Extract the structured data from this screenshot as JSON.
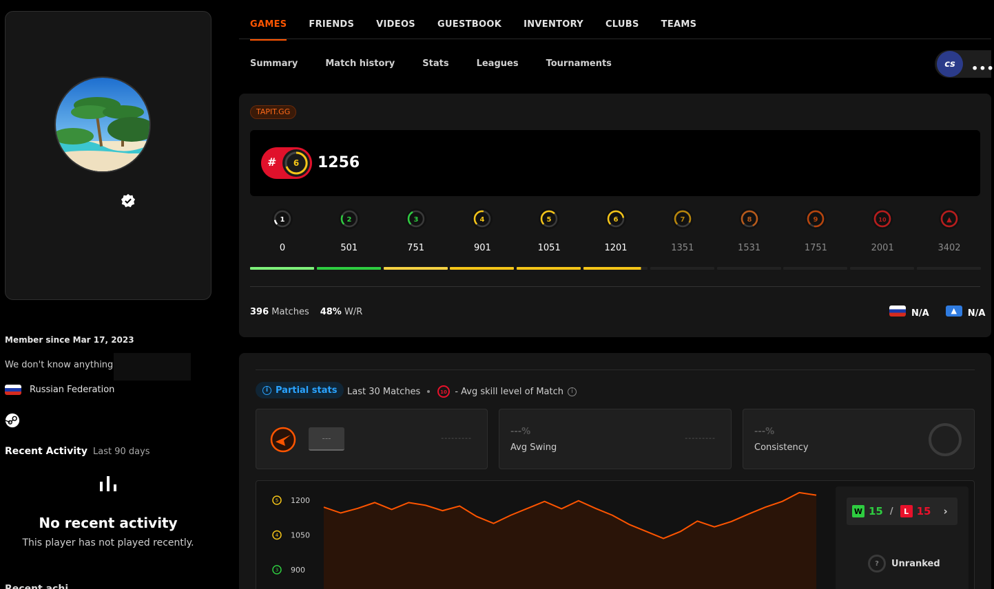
{
  "nav": {
    "main_tabs": [
      "GAMES",
      "FRIENDS",
      "VIDEOS",
      "GUESTBOOK",
      "INVENTORY",
      "CLUBS",
      "TEAMS"
    ],
    "sub_tabs": [
      "Summary",
      "Match history",
      "Stats",
      "Leagues",
      "Tournaments"
    ],
    "game_logo": "cs",
    "more": "•••"
  },
  "profile": {
    "member_since": "Member since Mar 17, 2023",
    "bio": "We don't know anything",
    "country": "Russian Federation",
    "recent_activity_title": "Recent Activity",
    "recent_activity_sub": "Last 90 days",
    "no_recent_title": "No recent activity",
    "no_recent_sub": "This player has not played recently.",
    "cut_text": "Recent achi..."
  },
  "rating": {
    "badge": "TAPIT.GG",
    "hash": "#",
    "current_level": "6",
    "elo": "1256",
    "levels": [
      {
        "label": "1",
        "value": "0",
        "color": "#ffffff",
        "bar": "#7ef07a",
        "active": true
      },
      {
        "label": "2",
        "value": "501",
        "color": "#2ecc40",
        "bar": "#2ecc40",
        "active": true
      },
      {
        "label": "3",
        "value": "751",
        "color": "#2ecc40",
        "bar": "#f5d142",
        "active": true
      },
      {
        "label": "4",
        "value": "901",
        "color": "#f5c518",
        "bar": "#f5c518",
        "active": true
      },
      {
        "label": "5",
        "value": "1051",
        "color": "#f5c518",
        "bar": "#f5c518",
        "active": true
      },
      {
        "label": "6",
        "value": "1201",
        "color": "#f5c518",
        "bar": "#f5c518",
        "active": true
      },
      {
        "label": "7",
        "value": "1351",
        "color": "#b8860b",
        "bar": "#222",
        "active": false
      },
      {
        "label": "8",
        "value": "1531",
        "color": "#b85a1a",
        "bar": "#222",
        "active": false
      },
      {
        "label": "9",
        "value": "1751",
        "color": "#b8450d",
        "bar": "#222",
        "active": false
      },
      {
        "label": "10",
        "value": "2001",
        "color": "#b81c1c",
        "bar": "#222",
        "active": false
      },
      {
        "label": "",
        "value": "3402",
        "color": "#b81c1c",
        "bar": "#222",
        "active": false
      }
    ],
    "level6_progress": 0.9,
    "matches_count": "396",
    "matches_label": "Matches",
    "winrate": "48%",
    "winrate_label": "W/R",
    "region_rank_country": "N/A",
    "region_rank_world": "N/A"
  },
  "stats": {
    "partial_label": "Partial stats",
    "last_matches": "Last 30 Matches",
    "avg_skill_badge": "10",
    "avg_skill_label": "- Avg skill level of Match",
    "card_map": {
      "value": "---",
      "dash": "---------"
    },
    "card_swing": {
      "value": "---%",
      "label": "Avg Swing",
      "dash": "---------"
    },
    "card_consistency": {
      "value": "---%",
      "label": "Consistency"
    },
    "wins": "15",
    "losses": "15",
    "win_letter": "W",
    "loss_letter": "L",
    "unranked_label": "Unranked",
    "unranked_icon": "?"
  },
  "chart_data": {
    "type": "line",
    "y_ticks": [
      {
        "level": "5",
        "value": "1200",
        "color": "#f5c518"
      },
      {
        "level": "4",
        "value": "1050",
        "color": "#f5c518"
      },
      {
        "level": "3",
        "value": "900",
        "color": "#2ecc40"
      }
    ],
    "ylim": [
      850,
      1250
    ],
    "line_color": "#ff5500",
    "values": [
      1170,
      1145,
      1165,
      1190,
      1160,
      1190,
      1178,
      1155,
      1175,
      1130,
      1100,
      1135,
      1165,
      1195,
      1163,
      1198,
      1165,
      1135,
      1095,
      1065,
      1035,
      1065,
      1110,
      1085,
      1108,
      1140,
      1170,
      1195,
      1233,
      1222
    ]
  }
}
